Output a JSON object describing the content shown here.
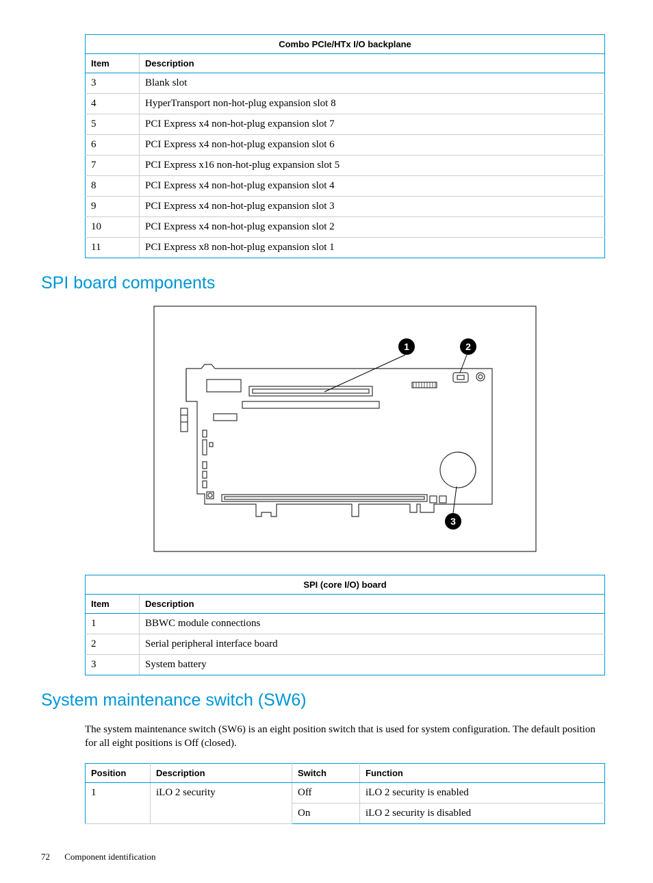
{
  "table1": {
    "title": "Combo PCIe/HTx I/O backplane",
    "headers": {
      "item": "Item",
      "desc": "Description"
    },
    "rows": [
      {
        "item": "3",
        "desc": "Blank slot"
      },
      {
        "item": "4",
        "desc": "HyperTransport non-hot-plug expansion slot 8"
      },
      {
        "item": "5",
        "desc": "PCI Express x4 non-hot-plug expansion slot 7"
      },
      {
        "item": "6",
        "desc": "PCI Express x4 non-hot-plug expansion slot 6"
      },
      {
        "item": "7",
        "desc": "PCI Express x16 non-hot-plug expansion slot 5"
      },
      {
        "item": "8",
        "desc": "PCI Express x4 non-hot-plug expansion slot 4"
      },
      {
        "item": "9",
        "desc": "PCI Express x4 non-hot-plug expansion slot 3"
      },
      {
        "item": "10",
        "desc": "PCI Express x4 non-hot-plug expansion slot 2"
      },
      {
        "item": "11",
        "desc": "PCI Express x8 non-hot-plug expansion slot 1"
      }
    ]
  },
  "heading1": "SPI board components",
  "diagram": {
    "callouts": {
      "c1": "1",
      "c2": "2",
      "c3": "3"
    }
  },
  "table2": {
    "title": "SPI (core I/O) board",
    "headers": {
      "item": "Item",
      "desc": "Description"
    },
    "rows": [
      {
        "item": "1",
        "desc": "BBWC module connections"
      },
      {
        "item": "2",
        "desc": "Serial peripheral interface board"
      },
      {
        "item": "3",
        "desc": "System battery"
      }
    ]
  },
  "heading2": "System maintenance switch (SW6)",
  "paragraph": "The system maintenance switch (SW6) is an eight position switch that is used for system configuration. The default position for all eight positions is Off (closed).",
  "table3": {
    "headers": {
      "pos": "Position",
      "desc": "Description",
      "sw": "Switch",
      "fn": "Function"
    },
    "rows": [
      {
        "pos": "1",
        "desc": "iLO 2 security",
        "sw": "Off",
        "fn": "iLO 2 security is enabled"
      },
      {
        "pos": "",
        "desc": "",
        "sw": "On",
        "fn": "iLO 2 security is disabled"
      }
    ]
  },
  "footer": {
    "page": "72",
    "section": "Component identification"
  }
}
